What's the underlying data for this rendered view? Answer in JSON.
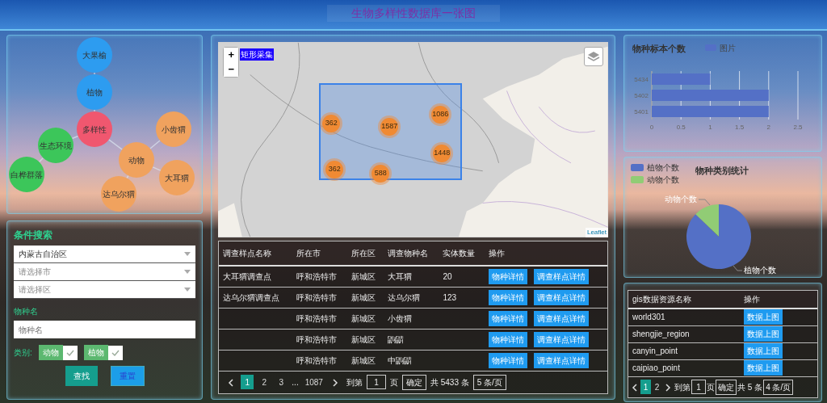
{
  "header": {
    "title": "生物多样性数据库一张图"
  },
  "graph": {
    "root": {
      "label": "多样性",
      "color": "#f0576f",
      "children": [
        {
          "label": "植物",
          "color": "#2d9cf0",
          "children": [
            {
              "label": "大果榆",
              "color": "#2d9cf0"
            }
          ]
        },
        {
          "label": "生态环境",
          "color": "#3cc65a",
          "children": [
            {
              "label": "白桦群落",
              "color": "#3cc65a"
            }
          ]
        },
        {
          "label": "动物",
          "color": "#f0a25e",
          "children": [
            {
              "label": "小齿猬",
              "color": "#f0a25e"
            },
            {
              "label": "大耳猬",
              "color": "#f0a25e"
            },
            {
              "label": "达乌尔猬",
              "color": "#f0a25e"
            }
          ]
        }
      ]
    }
  },
  "search": {
    "title": "条件搜索",
    "selects": [
      {
        "value": "内蒙古自治区"
      },
      {
        "placeholder": "请选择市"
      },
      {
        "placeholder": "请选择区"
      }
    ],
    "name_label": "物种名",
    "name_field": {
      "placeholder": "物种名"
    },
    "category_label": "类别:",
    "categories": [
      {
        "label": "动物",
        "checked": true
      },
      {
        "label": "植物",
        "checked": true
      }
    ],
    "buttons": [
      {
        "label": "查找",
        "kind": "search"
      },
      {
        "label": "重置",
        "kind": "reset"
      }
    ]
  },
  "map": {
    "zoom_in": "+",
    "zoom_out": "−",
    "draw_tool": "矩形采集",
    "clusters": [
      "362",
      "1587",
      "1086",
      "1448",
      "362",
      "588"
    ],
    "attribution": "Leaflet"
  },
  "survey_table": {
    "columns": [
      "调查样点名称",
      "所在市",
      "所在区",
      "调查物种名",
      "实体数量",
      "操作"
    ],
    "rows": [
      {
        "site": "大耳猬调查点",
        "city": "呼和浩特市",
        "district": "新城区",
        "species": "大耳猬",
        "count": "20",
        "actions": [
          "物种详情",
          "调查样点详情"
        ]
      },
      {
        "site": "达乌尔猬调查点",
        "city": "呼和浩特市",
        "district": "新城区",
        "species": "达乌尔猬",
        "count": "123",
        "actions": [
          "物种详情",
          "调查样点详情"
        ]
      },
      {
        "city": "呼和浩特市",
        "district": "新城区",
        "species": "小齿猬",
        "actions": [
          "物种详情",
          "调查样点详情"
        ]
      },
      {
        "city": "呼和浩特市",
        "district": "新城区",
        "species": "鼩鼱",
        "actions": [
          "物种详情",
          "调查样点详情"
        ]
      },
      {
        "city": "呼和浩特市",
        "district": "新城区",
        "species": "中鼩鼱",
        "actions": [
          "物种详情",
          "调查样点详情"
        ]
      }
    ],
    "pagination": {
      "pages": [
        {
          "label": "1",
          "selected": true
        },
        {
          "label": "2",
          "selected": false
        },
        {
          "label": "3",
          "selected": false
        }
      ],
      "ellipsis": "...",
      "last_page": "1087",
      "goto_label": "到第",
      "goto_value": "1",
      "page_unit": "页",
      "confirm": "确定",
      "total": "共 5433 条",
      "page_size": "5 条/页"
    }
  },
  "specimen_chart": {
    "chart_data": {
      "type": "bar",
      "orientation": "horizontal",
      "title": "物种标本个数",
      "categories": [
        "5434",
        "5402",
        "5401"
      ],
      "series": [
        {
          "name": "图片",
          "color": "#5470c6",
          "values": [
            1,
            2,
            2
          ]
        }
      ],
      "xlim": [
        0,
        2.5
      ],
      "grid": true,
      "xticks": [
        0,
        0.5,
        1,
        1.5,
        2,
        2.5
      ]
    }
  },
  "category_chart": {
    "title": "物种类别统计",
    "legend": [
      {
        "label": "植物个数",
        "color": "#5470c6"
      },
      {
        "label": "动物个数",
        "color": "#91cc75"
      }
    ],
    "slice_labels": [
      "动物个数",
      "植物个数"
    ]
  },
  "gis_table": {
    "columns": [
      "gis数据资源名称",
      "操作"
    ],
    "rows": [
      {
        "name": "world301",
        "action": "数据上图"
      },
      {
        "name": "shengjie_region",
        "action": "数据上图"
      },
      {
        "name": "canyin_point",
        "action": "数据上图"
      },
      {
        "name": "caipiao_point",
        "action": "数据上图"
      }
    ],
    "pagination": {
      "pages": [
        {
          "label": "1",
          "selected": true
        },
        {
          "label": "2",
          "selected": false
        }
      ],
      "goto_label": "到第",
      "goto_value": "1",
      "page_unit": "页",
      "confirm": "确定",
      "total": "共 5 条",
      "page_size": "4 条/页"
    }
  }
}
